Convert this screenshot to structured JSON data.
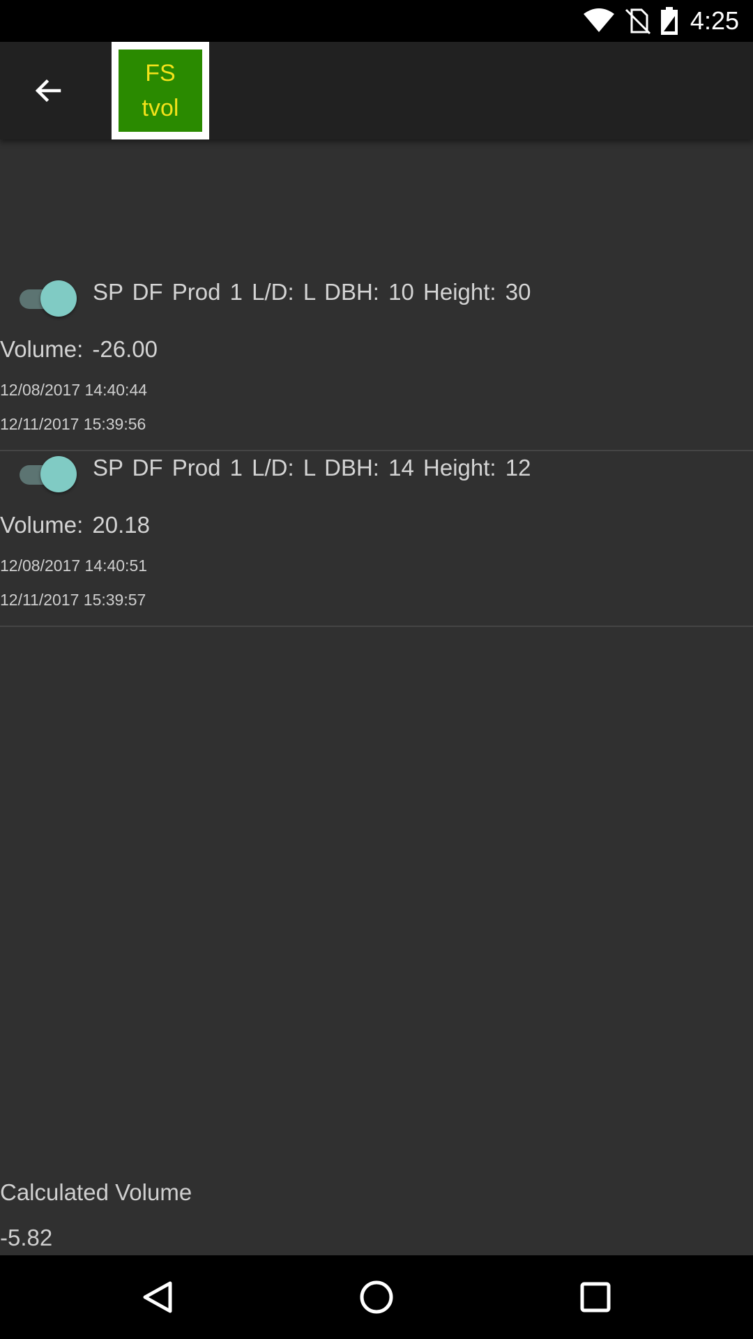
{
  "status_bar": {
    "time": "4:25",
    "icons": [
      "wifi-icon",
      "no-sim-icon",
      "battery-icon"
    ]
  },
  "toolbar": {
    "back_icon": "arrow-left-icon",
    "logo": {
      "line1": "FS",
      "line2": "tvol",
      "bg_color": "#2a8a00",
      "text_color": "#f2e21a"
    }
  },
  "items": [
    {
      "enabled": true,
      "title": "SP DF Prod 1 L/D: L DBH: 10 Height: 30",
      "volume": "Volume: -26.00",
      "created": "12/08/2017 14:40:44",
      "modified": "12/11/2017 15:39:56"
    },
    {
      "enabled": true,
      "title": "SP DF Prod 1 L/D: L DBH: 14 Height: 12",
      "volume": "Volume: 20.18",
      "created": "12/08/2017 14:40:51",
      "modified": "12/11/2017 15:39:57"
    }
  ],
  "footer": {
    "label": "Calculated Volume",
    "value": "-5.82"
  },
  "nav_bar": {
    "buttons": [
      "back-triangle-icon",
      "home-circle-icon",
      "recents-square-icon"
    ]
  },
  "colors": {
    "background": "#303030",
    "toolbar": "#212121",
    "toggle_accent": "#80cbc4"
  }
}
